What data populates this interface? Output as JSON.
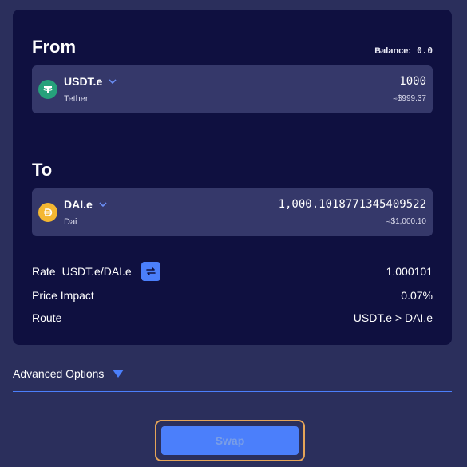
{
  "from": {
    "title": "From",
    "balance_label": "Balance:",
    "balance_value": "0.0",
    "token": {
      "symbol": "USDT.e",
      "name": "Tether",
      "amount": "1000",
      "usd": "≈$999.37",
      "icon": "tether-icon",
      "icon_glyph": "T",
      "color": "#26a17b"
    }
  },
  "to": {
    "title": "To",
    "token": {
      "symbol": "DAI.e",
      "name": "Dai",
      "amount": "1,000.1018771345409522",
      "usd": "≈$1,000.10",
      "icon": "dai-icon",
      "icon_glyph": "D",
      "color": "#f4b731"
    }
  },
  "rate": {
    "label": "Rate",
    "pair": "USDT.e/DAI.e",
    "value": "1.000101"
  },
  "price_impact": {
    "label": "Price Impact",
    "value": "0.07%"
  },
  "route": {
    "label": "Route",
    "value": "USDT.e > DAI.e"
  },
  "advanced_options": {
    "label": "Advanced Options"
  },
  "swap_button": {
    "label": "Swap"
  },
  "colors": {
    "accent": "#4b7ffb",
    "card": "#0f1040",
    "page": "#2b2f5c",
    "focus_ring": "#e5a458"
  }
}
